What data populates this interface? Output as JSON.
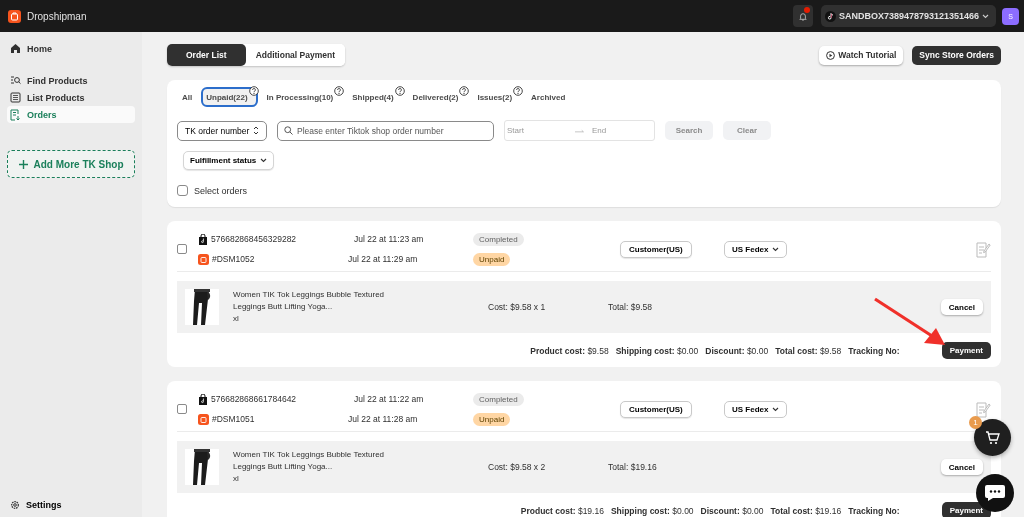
{
  "topbar": {
    "app_name": "Dropshipman",
    "account": "SANDBOX7389478793121351466",
    "avatar": "S"
  },
  "sidebar": {
    "items": [
      {
        "label": "Home",
        "selected": false
      },
      {
        "label": "Find Products",
        "selected": false
      },
      {
        "label": "List Products",
        "selected": false
      },
      {
        "label": "Orders",
        "selected": true
      }
    ],
    "add_shop": "Add More TK Shop",
    "settings": "Settings"
  },
  "view_tabs": [
    {
      "label": "Order List",
      "selected": true
    },
    {
      "label": "Additional Payment",
      "selected": false
    }
  ],
  "actions": [
    "Watch Tutorial",
    "Sync Store Orders"
  ],
  "filters": {
    "tabs": [
      {
        "label": "All",
        "selected": false,
        "help": false
      },
      {
        "label": "Unpaid(22)",
        "selected": true,
        "help": true
      },
      {
        "label": "In Processing(10)",
        "selected": false,
        "help": true
      },
      {
        "label": "Shipped(4)",
        "selected": false,
        "help": true
      },
      {
        "label": "Delivered(2)",
        "selected": false,
        "help": true
      },
      {
        "label": "Issues(2)",
        "selected": false,
        "help": true
      },
      {
        "label": "Archived",
        "selected": false,
        "help": false
      }
    ],
    "search_type": "TK order number",
    "search": {
      "placeholder": "Please enter Tiktok shop order number"
    },
    "date_start": {
      "placeholder": "Start"
    },
    "date_end": {
      "placeholder": "End"
    },
    "buttons": [
      "Search",
      "Clear"
    ],
    "fulfillment": "Fulfillment status",
    "select_all": {
      "label": "Select orders",
      "checked": false
    }
  },
  "orders": [
    {
      "checked": false,
      "tk_id": "576682868456329282",
      "tk_date": "Jul 22 at 11:23 am",
      "ds_id": "#DSM1052",
      "ds_date": "Jul 22 at 11:29 am",
      "statuses": [
        {
          "label": "Completed",
          "kind": "neutral"
        },
        {
          "label": "Unpaid",
          "kind": "warning"
        }
      ],
      "customer": "Customer(US)",
      "shipping": "US Fedex",
      "product": {
        "title": "Women TIK Tok Leggings Bubble Textured Leggings Butt Lifting Yoga...",
        "variant": "xl",
        "cost": "Cost: $9.58 x 1",
        "total": "Total: $9.58",
        "action": "Cancel"
      },
      "summary": [
        "**Product cost:** $9.58",
        "**Shipping cost:** $0.00",
        "**Discount:** $0.00",
        "**Total cost:** $9.58",
        "**Tracking No:**"
      ],
      "pay": "Payment"
    },
    {
      "checked": false,
      "tk_id": "576682868661784642",
      "tk_date": "Jul 22 at 11:22 am",
      "ds_id": "#DSM1051",
      "ds_date": "Jul 22 at 11:28 am",
      "statuses": [
        {
          "label": "Completed",
          "kind": "neutral"
        },
        {
          "label": "Unpaid",
          "kind": "warning"
        }
      ],
      "customer": "Customer(US)",
      "shipping": "US Fedex",
      "product": {
        "title": "Women TIK Tok Leggings Bubble Textured Leggings Butt Lifting Yoga...",
        "variant": "xl",
        "cost": "Cost: $9.58 x 2",
        "total": "Total: $19.16",
        "action": "Cancel"
      },
      "summary": [
        "**Product cost:** $19.16",
        "**Shipping cost:** $0.00",
        "**Discount:** $0.00",
        "**Total cost:** $19.16",
        "**Tracking No:**"
      ],
      "pay": "Payment"
    }
  ],
  "cart": {
    "count": "1"
  }
}
